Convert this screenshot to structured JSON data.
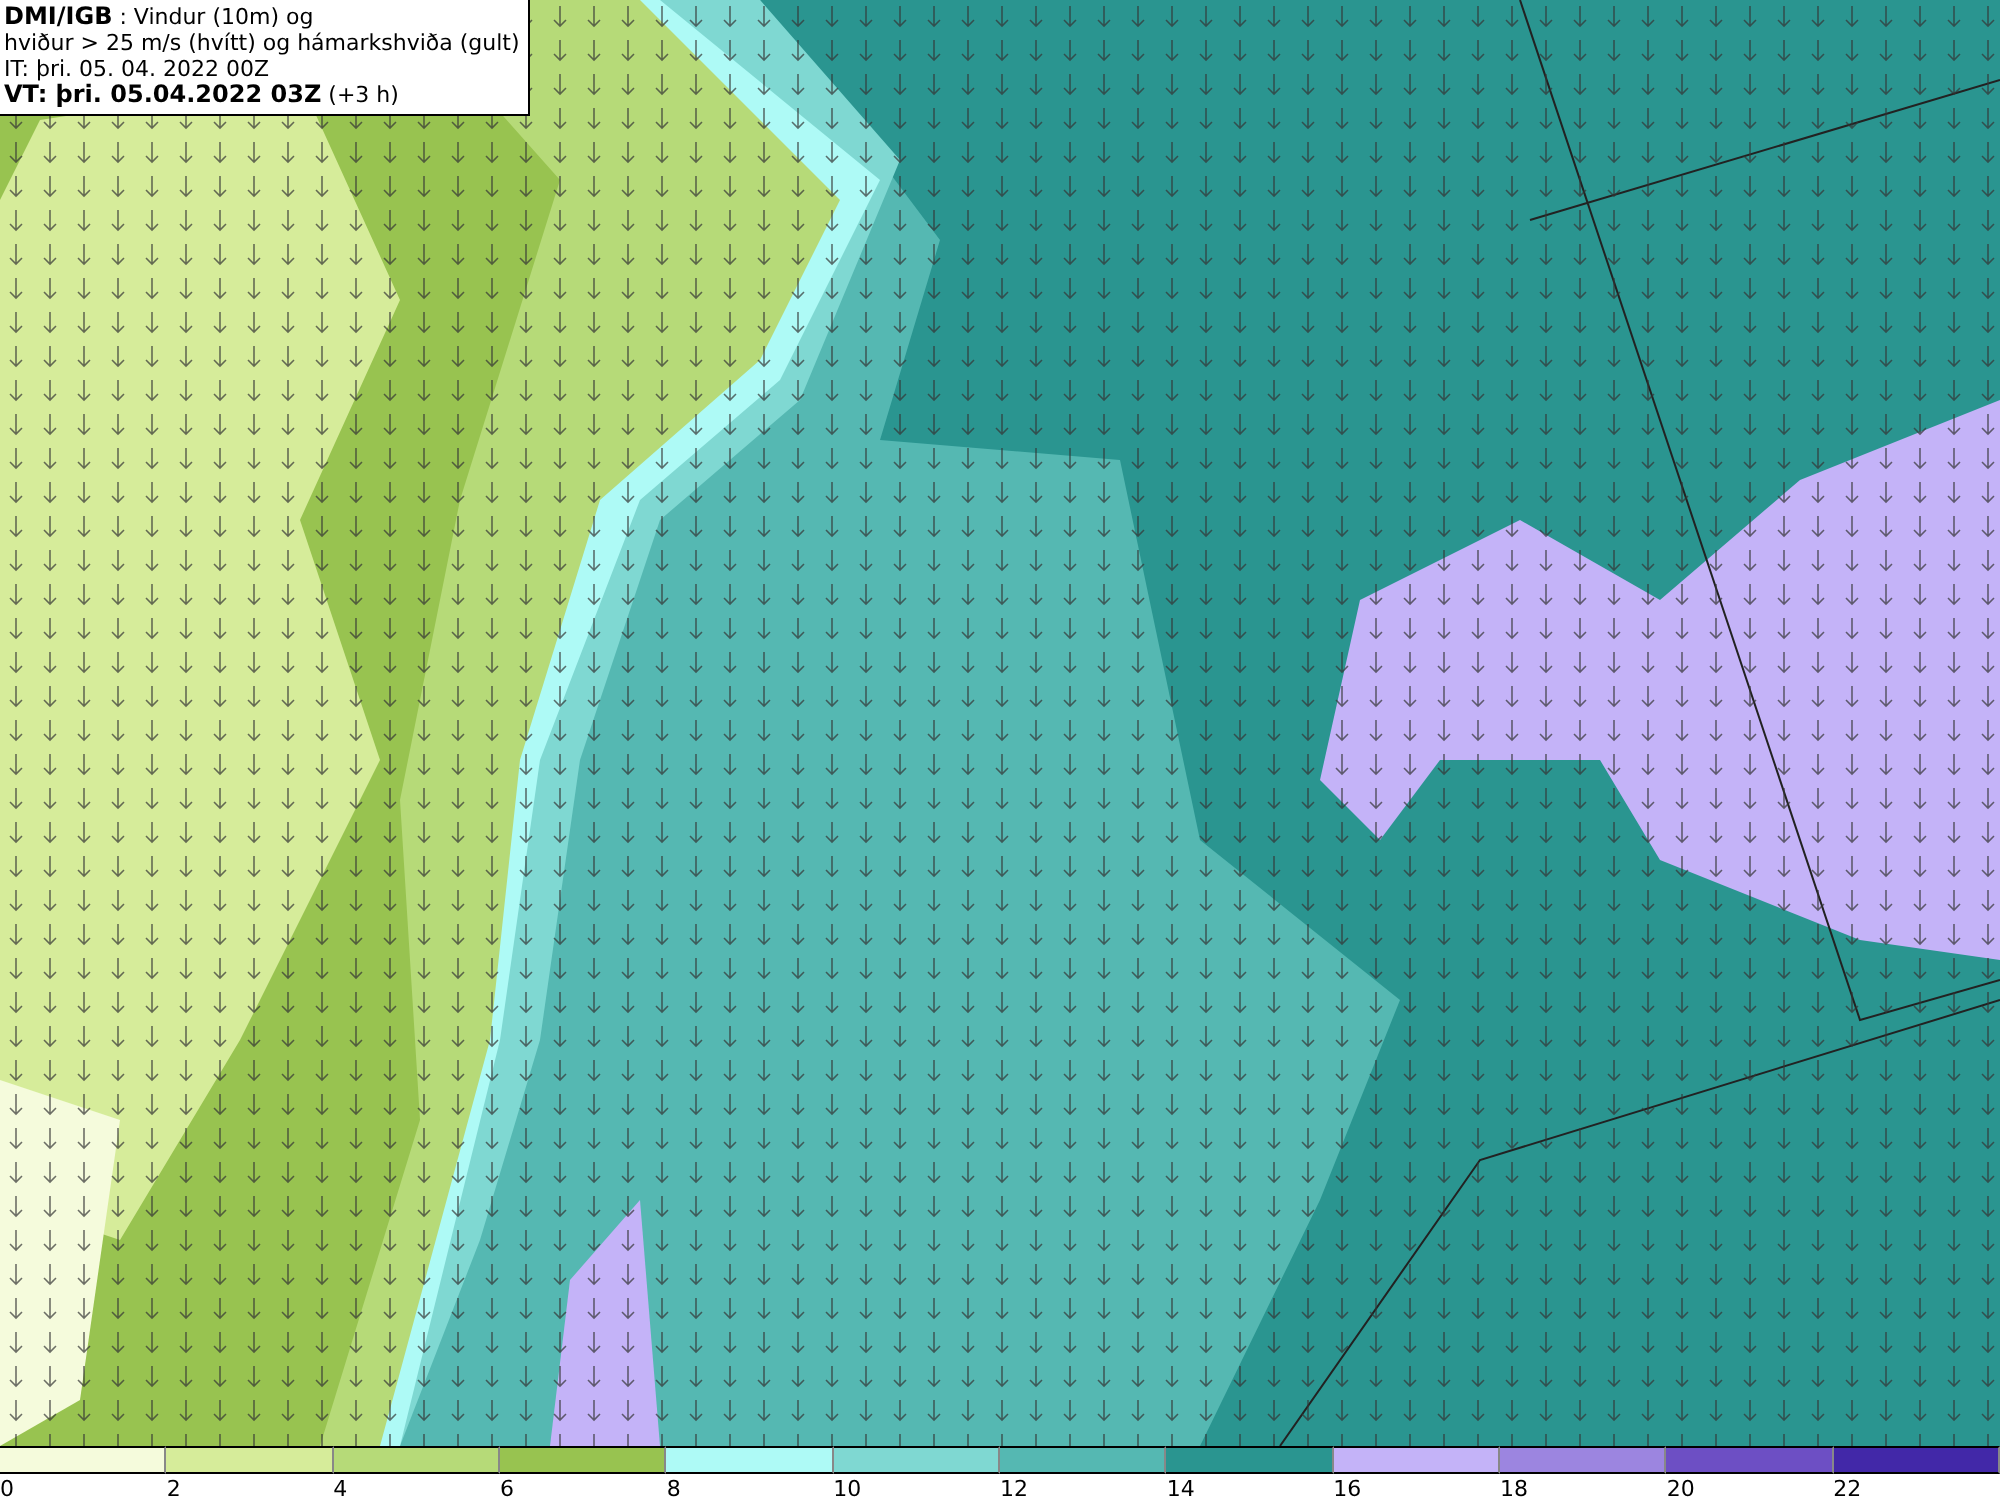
{
  "header": {
    "lines": [
      "**DMI/IGB** : Vindur (10m) og",
      "hviður > 25 m/s (hvítt) og hámarkshviða (gult)",
      "IT: þri. 05. 04. 2022 00Z",
      "**VT: þri. 05.04.2022 03Z** (+3 h)"
    ]
  },
  "legend": {
    "segments": [
      {
        "label": "0",
        "color": "#f5fbdc"
      },
      {
        "label": "2",
        "color": "#d6ec9a"
      },
      {
        "label": "4",
        "color": "#b6da78"
      },
      {
        "label": "6",
        "color": "#98c350"
      },
      {
        "label": "8",
        "color": "#aefaf6"
      },
      {
        "label": "10",
        "color": "#7fd8d2"
      },
      {
        "label": "12",
        "color": "#55b8b2"
      },
      {
        "label": "14",
        "color": "#2a9590"
      },
      {
        "label": "16",
        "color": "#c4b3f8"
      },
      {
        "label": "18",
        "color": "#9c85e0"
      },
      {
        "label": "20",
        "color": "#6d4fc4"
      },
      {
        "label": "22",
        "color": "#4228a8"
      }
    ]
  }
}
